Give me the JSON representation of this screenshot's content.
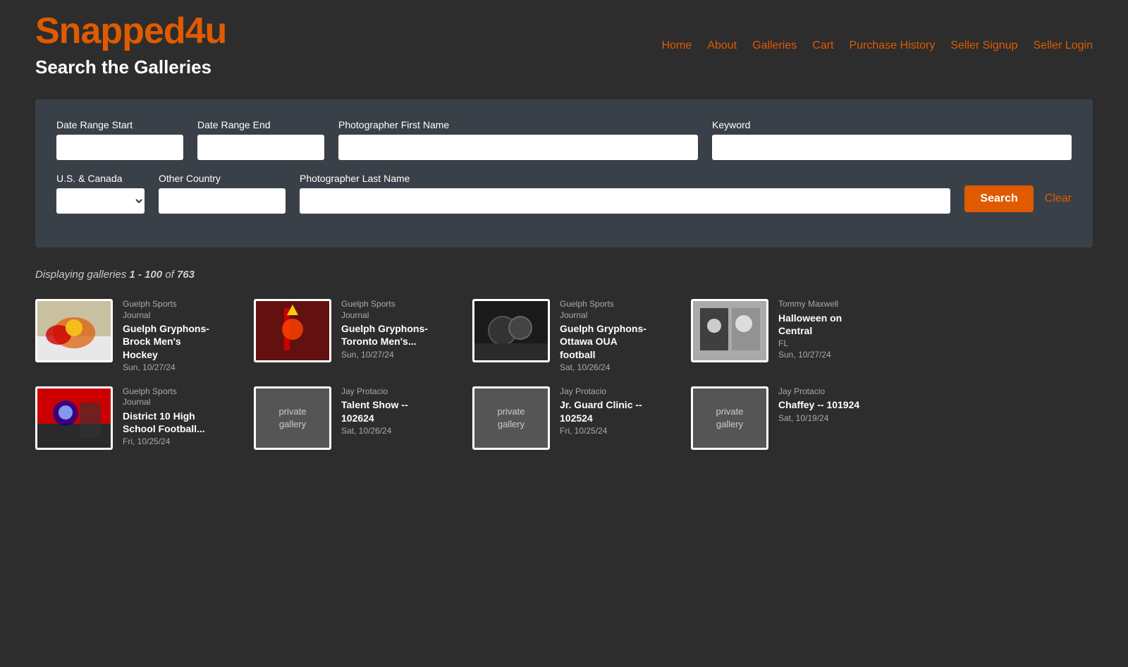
{
  "header": {
    "logo_main": "Snapped",
    "logo_accent": "4u",
    "page_title": "Search the Galleries",
    "nav": [
      {
        "label": "Home",
        "href": "#"
      },
      {
        "label": "About",
        "href": "#"
      },
      {
        "label": "Galleries",
        "href": "#"
      },
      {
        "label": "Cart",
        "href": "#"
      },
      {
        "label": "Purchase History",
        "href": "#"
      },
      {
        "label": "Seller Signup",
        "href": "#"
      },
      {
        "label": "Seller Login",
        "href": "#"
      }
    ]
  },
  "search_form": {
    "date_range_start_label": "Date Range Start",
    "date_range_end_label": "Date Range End",
    "photographer_first_name_label": "Photographer First Name",
    "keyword_label": "Keyword",
    "us_canada_label": "U.S. & Canada",
    "other_country_label": "Other Country",
    "photographer_last_name_label": "Photographer Last Name",
    "search_button": "Search",
    "clear_button": "Clear"
  },
  "results": {
    "display_text_prefix": "Displaying galleries ",
    "range": "1 - 100",
    "total_prefix": " of ",
    "total": "763"
  },
  "galleries": [
    {
      "id": 1,
      "publisher": "Guelph Sports\nJournal",
      "title": "Guelph Gryphons-\nBrock Men's\nHockey",
      "location": "",
      "date": "Sun, 10/27/24",
      "type": "image",
      "img_class": "img-hockey"
    },
    {
      "id": 2,
      "publisher": "Guelph Sports\nJournal",
      "title": "Guelph Gryphons-\nToronto Men's...",
      "location": "",
      "date": "Sun, 10/27/24",
      "type": "image",
      "img_class": "img-lacrosse"
    },
    {
      "id": 3,
      "publisher": "Guelph Sports\nJournal",
      "title": "Guelph Gryphons-\nOttawa OUA\nfootball",
      "location": "",
      "date": "Sat, 10/26/24",
      "type": "image",
      "img_class": "img-football"
    },
    {
      "id": 4,
      "publisher": "Tommy Maxwell",
      "title": "Halloween on\nCentral",
      "location": "FL",
      "date": "Sun, 10/27/24",
      "type": "image",
      "img_class": "img-halloween"
    },
    {
      "id": 5,
      "publisher": "Guelph Sports\nJournal",
      "title": "District 10 High\nSchool Football...",
      "location": "",
      "date": "Fri, 10/25/24",
      "type": "image",
      "img_class": "img-district"
    },
    {
      "id": 6,
      "publisher": "Jay Protacio",
      "title": "Talent Show --\n102624",
      "location": "",
      "date": "Sat, 10/26/24",
      "type": "private"
    },
    {
      "id": 7,
      "publisher": "Jay Protacio",
      "title": "Jr. Guard Clinic --\n102524",
      "location": "",
      "date": "Fri, 10/25/24",
      "type": "private"
    },
    {
      "id": 8,
      "publisher": "Jay Protacio",
      "title": "Chaffey -- 101924",
      "location": "",
      "date": "Sat, 10/19/24",
      "type": "private"
    }
  ]
}
